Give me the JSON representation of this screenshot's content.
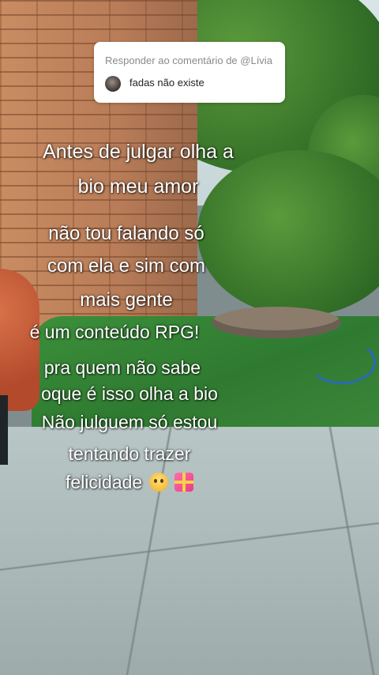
{
  "reply": {
    "header": "Responder ao comentário de @Lívia",
    "comment": "fadas não existe"
  },
  "captions": [
    "Antes de julgar olha a",
    "bio meu amor",
    "não tou falando só",
    "com ela e sim com",
    "mais gente",
    "é um conteúdo RPG!",
    "pra quem não sabe",
    "oque é isso olha a bio",
    "Não julguem só estou",
    "tentando trazer",
    "felicidade"
  ],
  "emojis": [
    "smiling-face-with-tear-icon",
    "heart-with-ribbon-icon"
  ]
}
